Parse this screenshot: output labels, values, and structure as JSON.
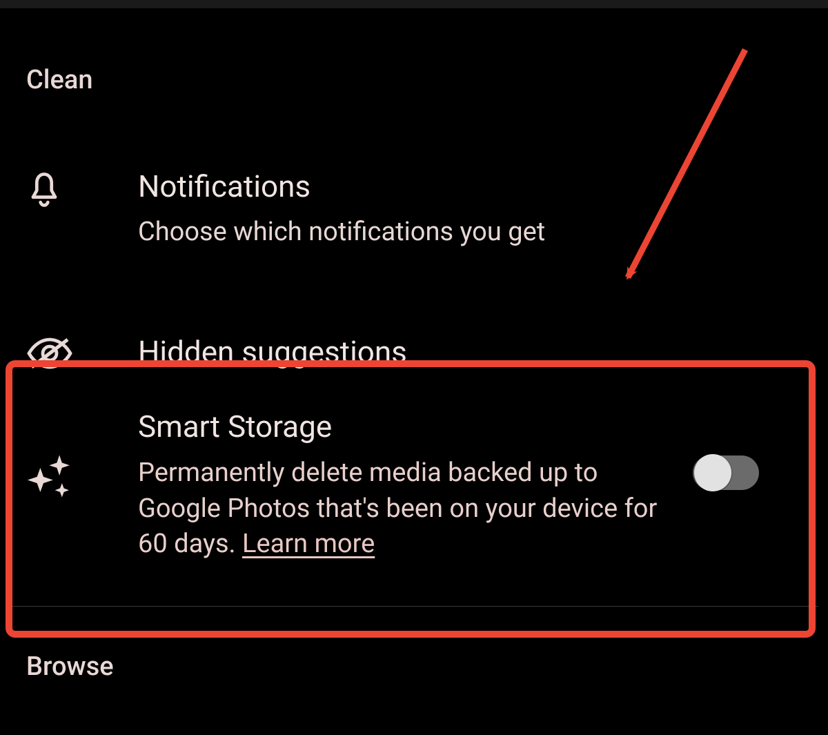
{
  "sections": {
    "clean": {
      "label": "Clean"
    },
    "browse": {
      "label": "Browse"
    }
  },
  "items": {
    "notifications": {
      "title": "Notifications",
      "subtitle": "Choose which notifications you get"
    },
    "hidden_suggestions": {
      "title": "Hidden suggestions"
    },
    "smart_storage": {
      "title": "Smart Storage",
      "body_prefix": "Permanently delete media backed up to Google Photos that's been on your device for 60 days. ",
      "learn_more": "Learn more",
      "toggle_on": false
    }
  },
  "annotation": {
    "highlight_color": "#ec4534"
  }
}
